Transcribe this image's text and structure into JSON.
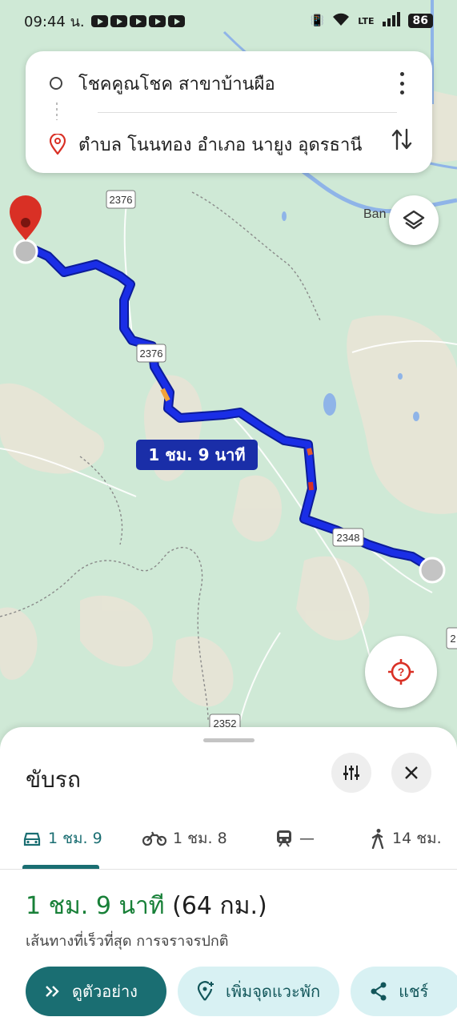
{
  "status_bar": {
    "time": "09:44 น.",
    "network": "LTE",
    "battery": "86"
  },
  "search": {
    "origin": "โชคคูณโชค สาขาบ้านผือ",
    "destination": "ตำบล โนนทอง อำเภอ นายูง อุดรธานี"
  },
  "map": {
    "road_labels": [
      "2376",
      "2376",
      "2348",
      "2352",
      "2"
    ],
    "place_label": "Ban",
    "route_time_label": "1 ชม. 9 นาที",
    "colors": {
      "route": "#1a2ee6",
      "route_outline": "#0c1c9a",
      "land": "#cfe9d6",
      "hills": "#e9e6dc",
      "river": "#8fb4e8",
      "pin": "#d93025"
    }
  },
  "sheet": {
    "title": "ขับรถ",
    "modes": [
      {
        "name": "car",
        "label": "1 ชม. 9",
        "active": true
      },
      {
        "name": "motorbike",
        "label": "1 ชม. 8",
        "active": false
      },
      {
        "name": "transit",
        "label": "—",
        "active": false
      },
      {
        "name": "walk",
        "label": "14 ชม.",
        "active": false
      }
    ],
    "duration": "1 ชม. 9 นาที",
    "distance": "(64 กม.)",
    "subtitle": "เส้นทางที่เร็วที่สุด การจราจรปกติ",
    "actions": {
      "preview": "ดูตัวอย่าง",
      "add_stop": "เพิ่มจุดแวะพัก",
      "share": "แชร์"
    },
    "accent": "#1a6e72"
  }
}
